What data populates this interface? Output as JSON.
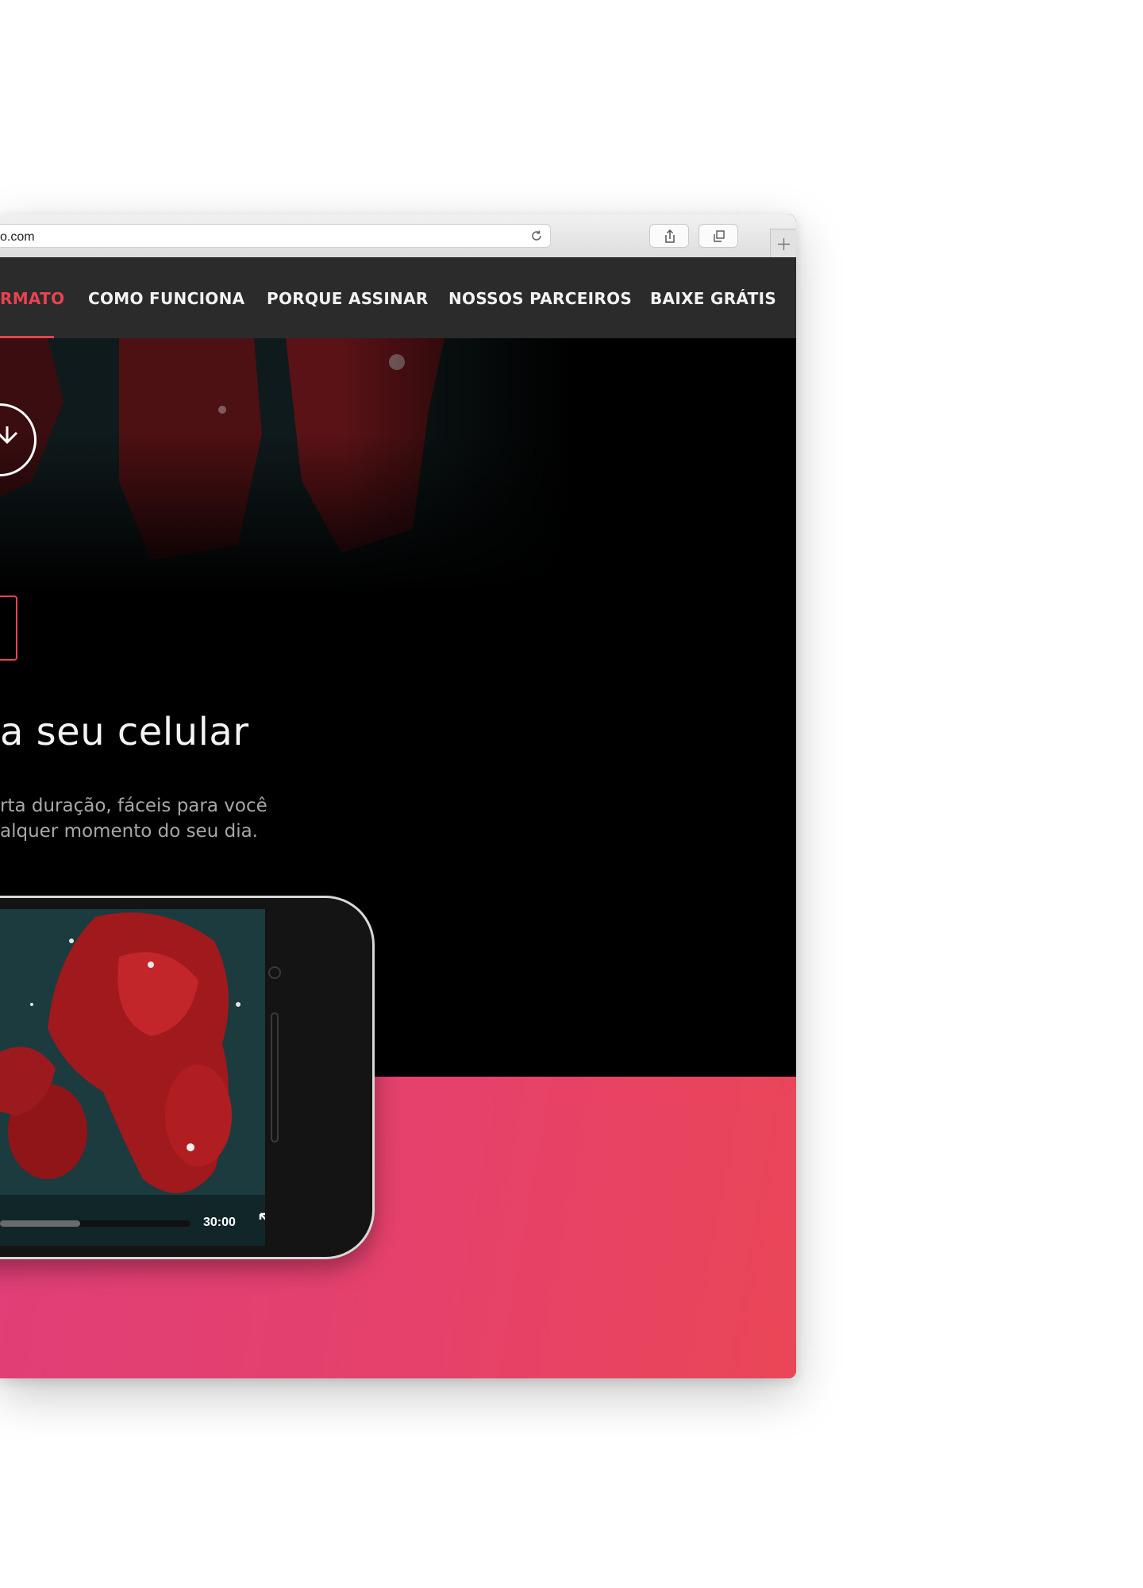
{
  "browser": {
    "url_text": "o.com",
    "icons": [
      "reload-icon",
      "share-icon",
      "tabs-icon",
      "new-tab-icon"
    ]
  },
  "nav": {
    "items": [
      {
        "label": "RMATO",
        "active": true
      },
      {
        "label": "COMO FUNCIONA",
        "active": false
      },
      {
        "label": "PORQUE ASSINAR",
        "active": false
      },
      {
        "label": "NOSSOS PARCEIROS",
        "active": false
      },
      {
        "label": "BAIXE GRÁTIS",
        "active": false
      }
    ]
  },
  "hero": {
    "headline": "a seu celular",
    "subtitle_line1": "rta duração, fáceis para você",
    "subtitle_line2": "alquer momento do seu dia.",
    "icons": [
      "play-circle-icon",
      "phone-device-icon"
    ]
  },
  "player": {
    "time": "30:00",
    "progress": 0.42,
    "icons": [
      "expand-icon"
    ]
  },
  "colors": {
    "accent": "#e8434f",
    "nav_bg": "#2b2b2b",
    "pink_start": "#df3f78",
    "pink_end": "#ea4657"
  }
}
